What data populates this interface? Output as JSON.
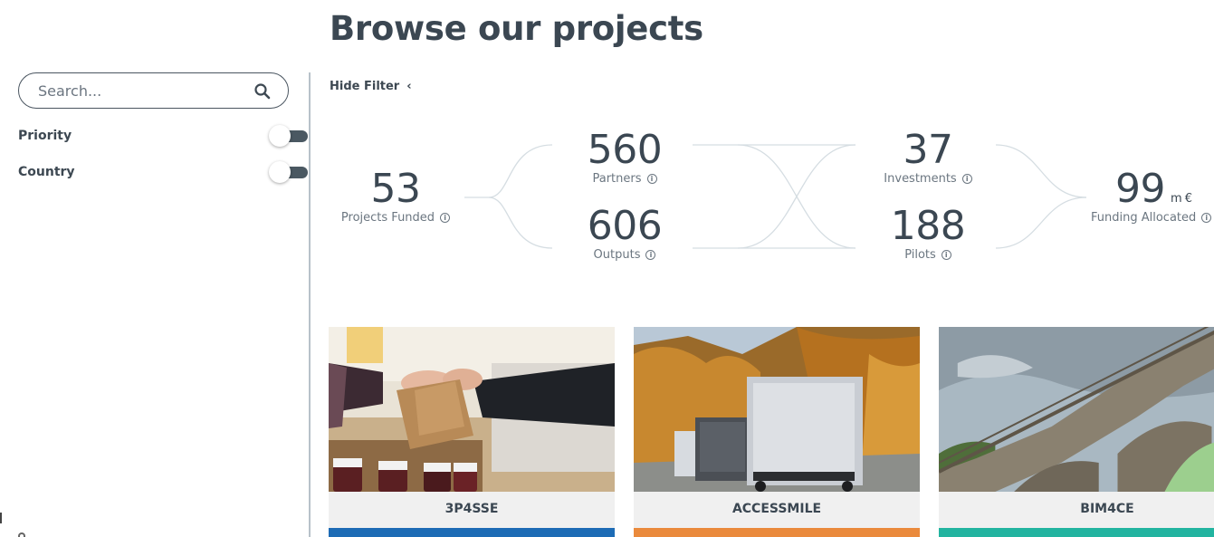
{
  "page": {
    "title": "Browse our projects"
  },
  "sidebar": {
    "search_placeholder": "Search...",
    "filters": [
      {
        "label": "Priority"
      },
      {
        "label": "Country"
      }
    ]
  },
  "filter_toggle": {
    "label": "Hide Filter",
    "chevron": "‹"
  },
  "stats": {
    "projects_funded": {
      "value": "53",
      "label": "Projects Funded"
    },
    "partners": {
      "value": "560",
      "label": "Partners"
    },
    "outputs": {
      "value": "606",
      "label": "Outputs"
    },
    "investments": {
      "value": "37",
      "label": "Investments"
    },
    "pilots": {
      "value": "188",
      "label": "Pilots"
    },
    "funding": {
      "value": "99",
      "unit": "m €",
      "label": "Funding Allocated"
    }
  },
  "projects": [
    {
      "name": "3P4SSE",
      "accent": "#1d6bb5"
    },
    {
      "name": "ACCESSMILE",
      "accent": "#ea8a3c"
    },
    {
      "name": "BIM4CE",
      "accent": "#22b4a0"
    }
  ]
}
